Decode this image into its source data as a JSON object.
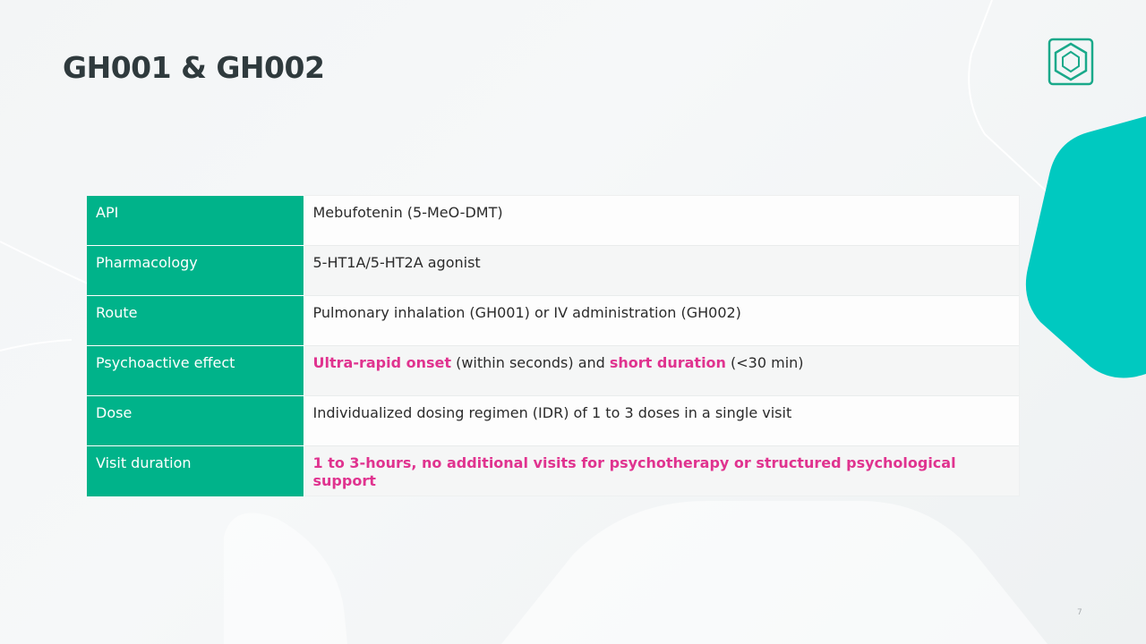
{
  "slide": {
    "title": "GH001 & GH002",
    "page_number": "7"
  },
  "logo": {
    "icon": "hexagon-logo-icon",
    "color": "#1aa98a"
  },
  "colors": {
    "label_background": "#00b38a",
    "highlight": "#e0338f",
    "accent_shape": "#00c9c0",
    "title": "#2f3a3d"
  },
  "table": {
    "rows": [
      {
        "label": "API",
        "value": {
          "text": "Mebufotenin (5-MeO-DMT)"
        }
      },
      {
        "label": "Pharmacology",
        "value": {
          "text": "5-HT1A/5-HT2A agonist"
        }
      },
      {
        "label": "Route",
        "value": {
          "text": "Pulmonary inhalation (GH001) or IV administration (GH002)"
        }
      },
      {
        "label": "Psychoactive effect",
        "value": {
          "highlight_1": "Ultra-rapid onset",
          "text_1": " (within seconds) and ",
          "highlight_2": "short duration",
          "text_2": " (<30 min)"
        }
      },
      {
        "label": "Dose",
        "value": {
          "text": "Individualized dosing regimen (IDR) of 1 to 3 doses in a single visit"
        }
      },
      {
        "label": "Visit duration",
        "value": {
          "highlight": "1 to 3-hours, no additional visits for psychotherapy or structured psychological support"
        }
      }
    ]
  }
}
